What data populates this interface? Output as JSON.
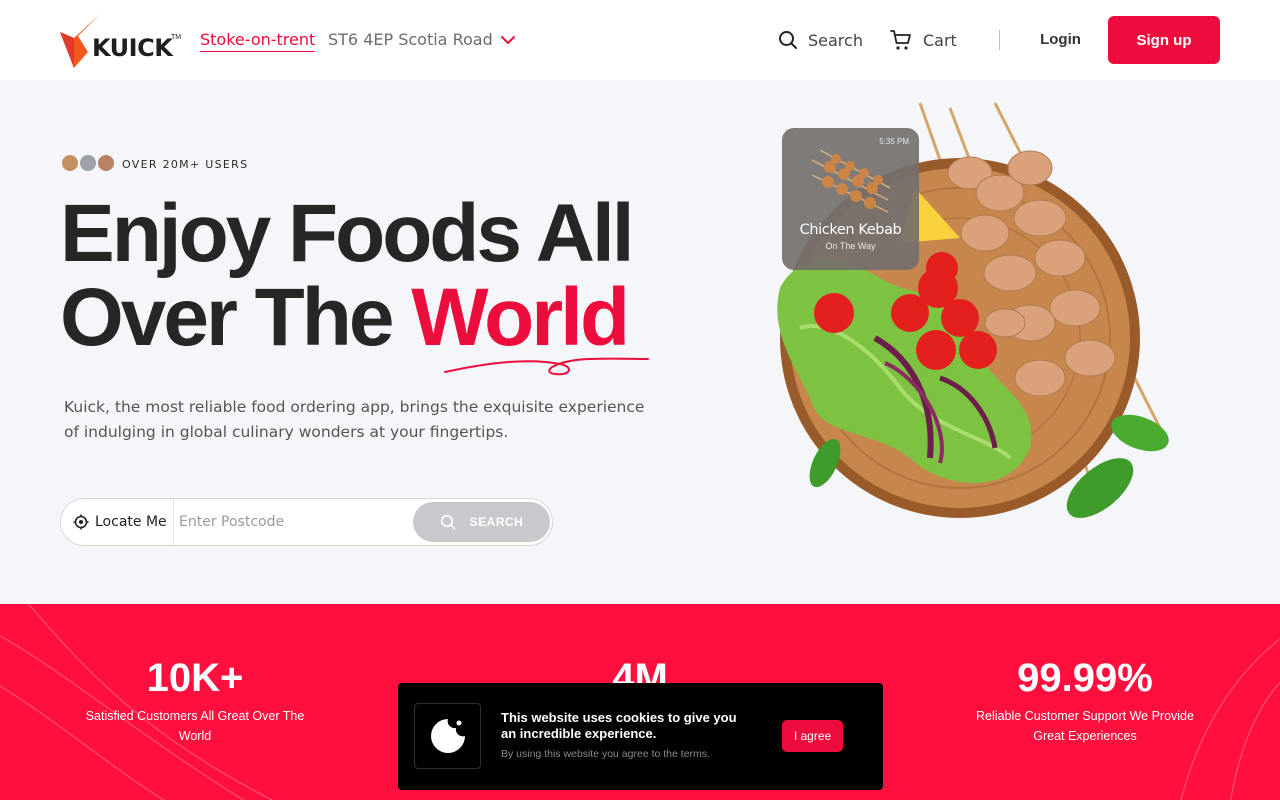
{
  "header": {
    "logo_text": "KUICK",
    "logo_tm": "TM",
    "location_city": "Stoke-on-trent",
    "location_address": "ST6 4EP Scotia Road",
    "search_label": "Search",
    "cart_label": "Cart",
    "login_label": "Login",
    "signup_label": "Sign up"
  },
  "hero": {
    "users_badge": "OVER 20M+ USERS",
    "headline_line1": "Enjoy Foods All",
    "headline_line2_prefix": "Over The ",
    "headline_accent": "World",
    "description": "Kuick, the most reliable food ordering app, brings the exquisite experience of indulging in global culinary wonders at your fingertips.",
    "locate_label": "Locate Me",
    "postcode_placeholder": "Enter Postcode",
    "search_button_label": "SEARCH"
  },
  "order_card": {
    "time": "5:35 PM",
    "title": "Chicken Kebab",
    "status": "On The Way"
  },
  "stats": [
    {
      "value": "10K+",
      "label": "Satisfied Customers All Great Over The World"
    },
    {
      "value": "4M",
      "label": ""
    },
    {
      "value": "99.99%",
      "label": "Reliable Customer Support We Provide Great Experiences"
    }
  ],
  "cookie": {
    "title": "This website uses cookies to give you an incredible experience.",
    "subtitle": "By using this website you agree to the terms.",
    "agree_label": "I agree"
  },
  "colors": {
    "accent": "#ec0d3c",
    "stats_bg": "#ff0f3e",
    "search_button_bg": "#c7c9cc"
  },
  "icons": [
    "kuick-logo",
    "chevron-down-icon",
    "search-icon",
    "cart-icon",
    "locate-icon",
    "cookie-icon"
  ]
}
